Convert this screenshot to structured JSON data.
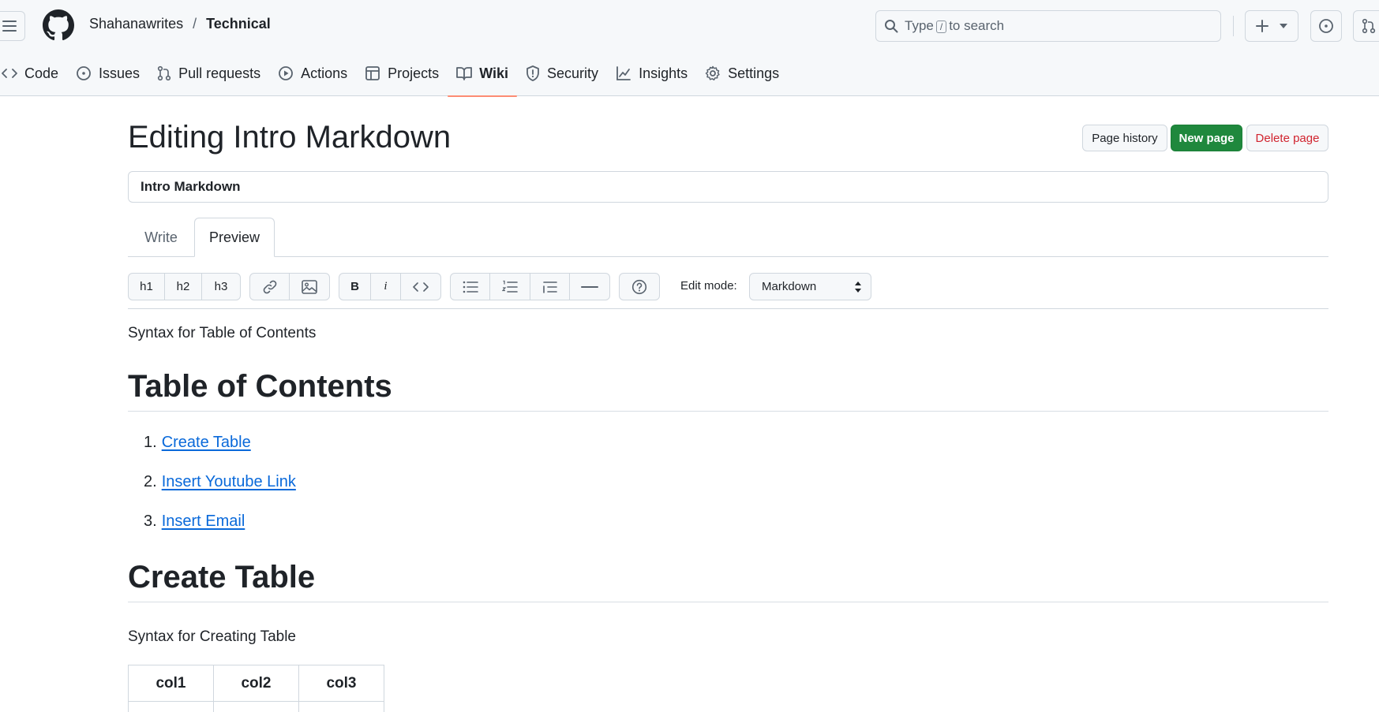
{
  "header": {
    "owner": "Shahanawrites",
    "separator": "/",
    "repo": "Technical",
    "search_prefix": "Type",
    "search_key": "/",
    "search_suffix": "to search"
  },
  "nav": {
    "items": [
      {
        "label": "Code",
        "icon": "code-icon"
      },
      {
        "label": "Issues",
        "icon": "issue-icon"
      },
      {
        "label": "Pull requests",
        "icon": "pull-request-icon"
      },
      {
        "label": "Actions",
        "icon": "play-icon"
      },
      {
        "label": "Projects",
        "icon": "table-icon"
      },
      {
        "label": "Wiki",
        "icon": "book-icon",
        "active": true
      },
      {
        "label": "Security",
        "icon": "shield-icon"
      },
      {
        "label": "Insights",
        "icon": "graph-icon"
      },
      {
        "label": "Settings",
        "icon": "gear-icon"
      }
    ]
  },
  "main": {
    "title": "Editing Intro Markdown",
    "page_history": "Page history",
    "new_page": "New page",
    "delete_page": "Delete page",
    "page_name_value": "Intro Markdown",
    "tabs": [
      {
        "label": "Write",
        "active": false
      },
      {
        "label": "Preview",
        "active": true
      }
    ]
  },
  "toolbar": {
    "h1": "h1",
    "h2": "h2",
    "h3": "h3",
    "bold": "B",
    "italic": "i",
    "edit_mode_label": "Edit mode:",
    "edit_mode_value": "Markdown"
  },
  "preview": {
    "intro": "Syntax for Table of Contents",
    "toc_heading": "Table of Contents",
    "toc_items": [
      {
        "num": "1.",
        "label": "Create Table"
      },
      {
        "num": "2.",
        "label": "Insert Youtube Link"
      },
      {
        "num": "3.",
        "label": "Insert Email"
      }
    ],
    "create_heading": "Create Table",
    "create_intro": "Syntax for Creating Table",
    "table_headers": [
      "col1",
      "col2",
      "col3"
    ]
  },
  "colors": {
    "accent": "#0969da",
    "primary_button": "#1f883d",
    "danger": "#d1242f",
    "nav_underline": "#fd8c73"
  }
}
